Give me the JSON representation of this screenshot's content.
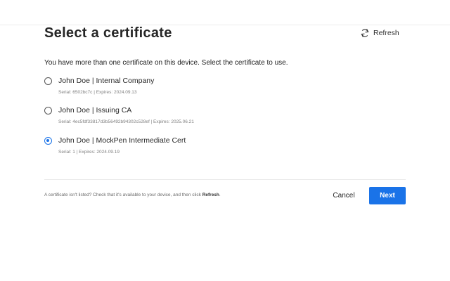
{
  "dialog": {
    "title": "Select a certificate",
    "refresh_label": "Refresh",
    "instruction": "You have more than one certificate on this device. Select the certificate to use.",
    "certificates": [
      {
        "name": "John Doe | Internal Company",
        "meta": "Serial: 6502bc7c | Expires: 2024.09.13",
        "selected": false
      },
      {
        "name": "John Doe | Issuing CA",
        "meta": "Serial: 4ec5fdf33817d3b56492b94302c528ef | Expires: 2025.06.21",
        "selected": false
      },
      {
        "name": "John Doe | MockPen Intermediate Cert",
        "meta": "Serial: 1 | Expires: 2024.09.19",
        "selected": true
      }
    ],
    "hint_prefix": "A certificate isn't listed? Check that it's available to your device, and then click ",
    "hint_emphasis": "Refresh",
    "hint_suffix": ".",
    "cancel_label": "Cancel",
    "next_label": "Next"
  },
  "colors": {
    "accent": "#1a73e8",
    "divider": "#ececec",
    "meta_text": "#808080"
  },
  "icons": {
    "refresh": "refresh-icon"
  }
}
